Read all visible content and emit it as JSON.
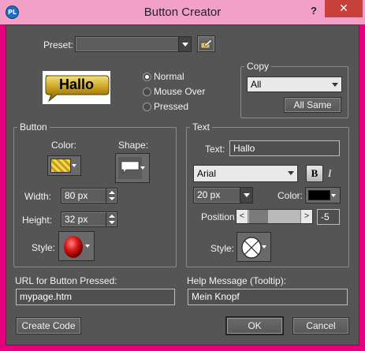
{
  "window": {
    "title": "Button Creator",
    "help": "?",
    "close": "✕",
    "icon_text": "PL"
  },
  "preset": {
    "label": "Preset:",
    "value": ""
  },
  "preview": {
    "text": "Hallo"
  },
  "states": {
    "normal": "Normal",
    "mouse_over": "Mouse Over",
    "pressed": "Pressed",
    "selected": "normal"
  },
  "copy": {
    "title": "Copy",
    "value": "All",
    "all_same": "All Same"
  },
  "button_group": {
    "title": "Button",
    "color_label": "Color:",
    "shape_label": "Shape:",
    "width_label": "Width:",
    "width_value": "80 px",
    "height_label": "Height:",
    "height_value": "32 px",
    "style_label": "Style:"
  },
  "text_group": {
    "title": "Text",
    "text_label": "Text:",
    "text_value": "Hallo",
    "font_value": "Arial",
    "bold": "B",
    "italic": "I",
    "size_value": "20 px",
    "color_label": "Color:",
    "color_value": "#000000",
    "position_label": "Position:",
    "position_value": "-5",
    "style_label": "Style:"
  },
  "url": {
    "label": "URL for Button Pressed:",
    "value": "mypage.htm"
  },
  "tooltip": {
    "label": "Help Message (Tooltip):",
    "value": "Mein Knopf"
  },
  "actions": {
    "create_code": "Create Code",
    "ok": "OK",
    "cancel": "Cancel"
  },
  "colors": {
    "accent_border": "#e4007a",
    "client_bg": "#555556",
    "close_bg": "#c7403a"
  }
}
